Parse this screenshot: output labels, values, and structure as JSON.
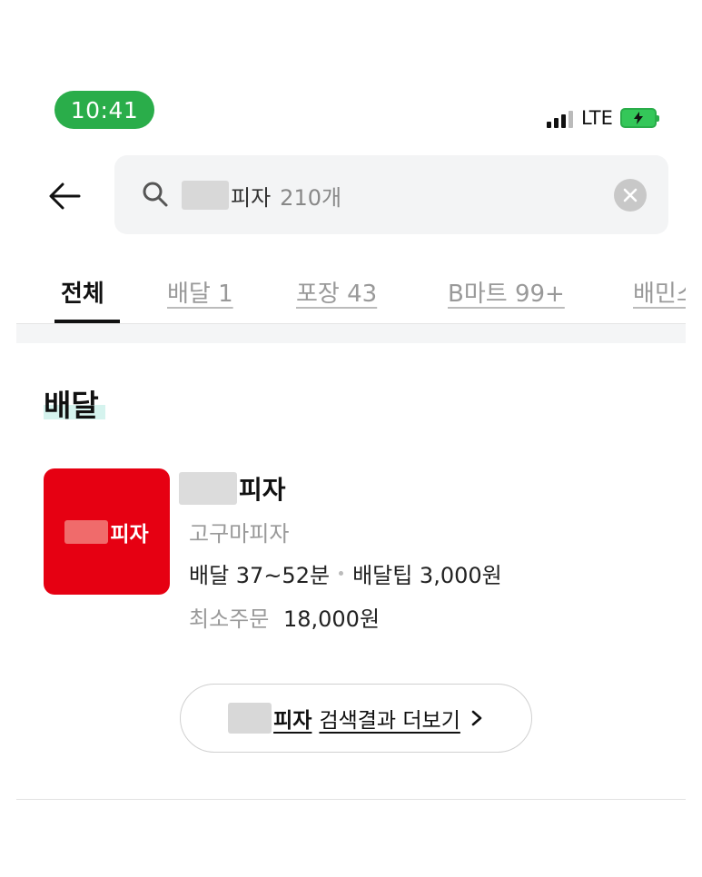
{
  "status_bar": {
    "time": "10:41",
    "network": "LTE",
    "signal_icon": "signal-bars-icon",
    "battery_icon": "battery-charging-icon"
  },
  "search": {
    "back_icon": "back-arrow-icon",
    "search_icon": "search-icon",
    "query": "피자",
    "result_count": "210개",
    "clear_icon": "clear-icon"
  },
  "tabs": [
    {
      "label": "전체",
      "active": true
    },
    {
      "label": "배달 1",
      "active": false
    },
    {
      "label": "포장 43",
      "active": false
    },
    {
      "label": "B마트 99+",
      "active": false
    },
    {
      "label": "배민스",
      "active": false
    }
  ],
  "section": {
    "title": "배달"
  },
  "store": {
    "thumb_text": "피자",
    "name": "피자",
    "menu": "고구마피자",
    "delivery_time": "배달 37~52분",
    "delivery_tip": "배달팁 3,000원",
    "min_order_label": "최소주문",
    "min_order_value": "18,000원"
  },
  "more": {
    "keyword": "피자",
    "label": "검색결과 더보기",
    "chevron": "›"
  },
  "colors": {
    "status_green": "#2aad4a",
    "thumb_red": "#e60012",
    "highlight_mint": "#d5f3ee"
  }
}
